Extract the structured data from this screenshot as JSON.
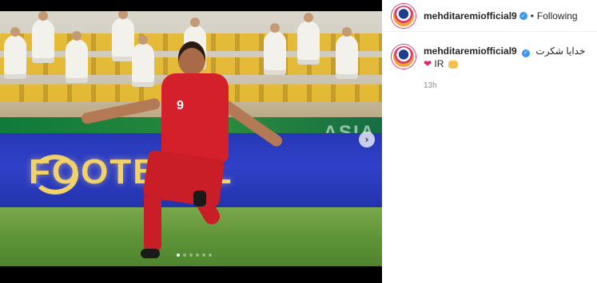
{
  "media": {
    "board_text": "FOOTBALL",
    "band_text": "ASIA",
    "player_number": "9",
    "carousel": {
      "count": 6,
      "active_index": 1
    }
  },
  "header": {
    "username": "mehditaremiofficial9",
    "separator": "•",
    "follow_status": "Following"
  },
  "caption": {
    "username": "mehditaremiofficial9",
    "text": "خدایا شکرت",
    "line2": "IR",
    "time": "13h"
  },
  "icons": {
    "verified": "verified-badge-icon",
    "next": "chevron-right-icon",
    "heart": "red-heart-icon",
    "praying": "praying-hands-icon"
  },
  "colors": {
    "accent": "#3897f0",
    "jersey": "#d4202b",
    "board": "#2737b5"
  }
}
